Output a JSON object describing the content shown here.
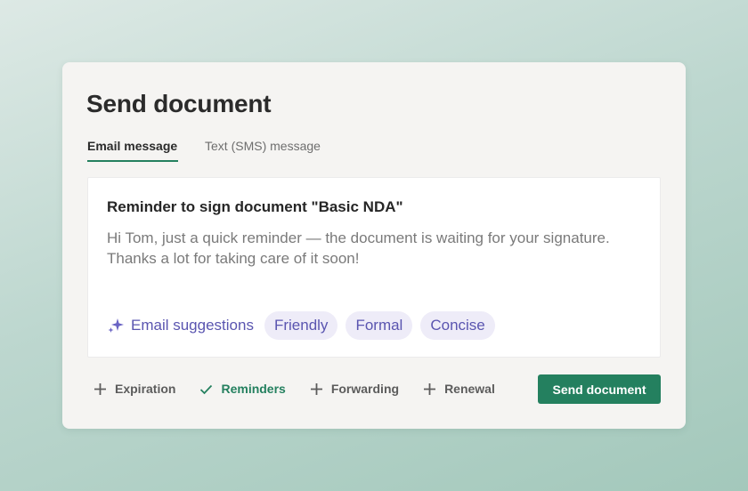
{
  "dialog": {
    "title": "Send document",
    "tabs": [
      {
        "label": "Email message",
        "active": true
      },
      {
        "label": "Text (SMS) message",
        "active": false
      }
    ]
  },
  "message": {
    "subject": "Reminder to sign document \"Basic NDA\"",
    "body": "Hi Tom, just a quick reminder — the document is waiting for your signature. Thanks a lot for taking care of it soon!"
  },
  "suggestions": {
    "label": "Email suggestions",
    "icon": "sparkle-icon",
    "chips": [
      "Friendly",
      "Formal",
      "Concise"
    ]
  },
  "options": [
    {
      "label": "Expiration",
      "icon": "plus-icon",
      "enabled": false
    },
    {
      "label": "Reminders",
      "icon": "check-icon",
      "enabled": true
    },
    {
      "label": "Forwarding",
      "icon": "plus-icon",
      "enabled": false
    },
    {
      "label": "Renewal",
      "icon": "plus-icon",
      "enabled": false
    }
  ],
  "send_button": {
    "label": "Send document"
  },
  "colors": {
    "accent_green": "#24805f",
    "suggestion_purple": "#5a55b0",
    "chip_background": "#eeecf8",
    "card_background": "#f5f4f2"
  }
}
